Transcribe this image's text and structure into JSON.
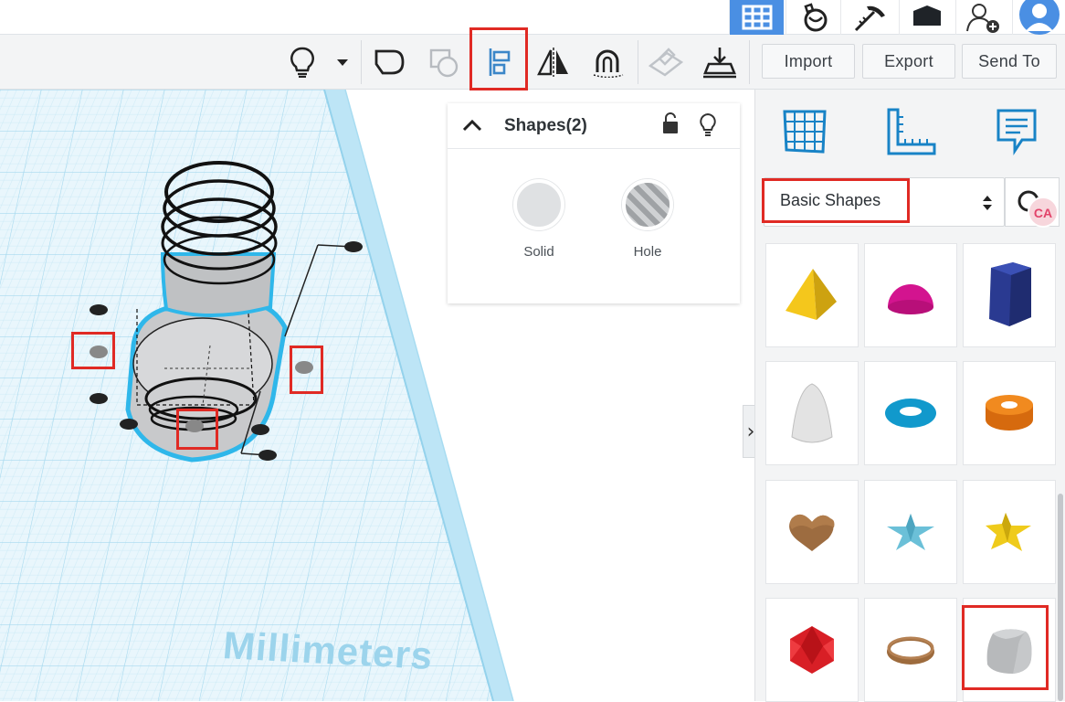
{
  "topbar": {
    "items": [
      "grid-view-icon",
      "tinker-icon",
      "pickaxe-icon",
      "box-icon",
      "add-user-icon",
      "avatar-icon"
    ]
  },
  "toolbar": {
    "import_label": "Import",
    "export_label": "Export",
    "send_to_label": "Send To"
  },
  "workplane": {
    "units_label": "Millimeters"
  },
  "shapes_panel": {
    "title": "Shapes(2)",
    "solid_label": "Solid",
    "hole_label": "Hole"
  },
  "library": {
    "category": "Basic Shapes",
    "shapes": [
      {
        "name": "pyramid",
        "color": "#f2c21a"
      },
      {
        "name": "half-sphere",
        "color": "#d3148f"
      },
      {
        "name": "polygon",
        "color": "#28348a"
      },
      {
        "name": "paraboloid",
        "color": "#d8d8d8"
      },
      {
        "name": "torus",
        "color": "#1196c7"
      },
      {
        "name": "tube",
        "color": "#e57c16"
      },
      {
        "name": "heart",
        "color": "#9b6a3f"
      },
      {
        "name": "star",
        "color": "#62b8d0"
      },
      {
        "name": "star-yellow",
        "color": "#f0cc1c"
      },
      {
        "name": "icosahedron",
        "color": "#d81f26"
      },
      {
        "name": "ring",
        "color": "#9d6b3d"
      },
      {
        "name": "round-cube",
        "color": "#b7b9bb"
      }
    ]
  },
  "colors": {
    "accent": "#4a8fe3",
    "highlight": "#e02a24",
    "grid": "#b8e4f5"
  }
}
